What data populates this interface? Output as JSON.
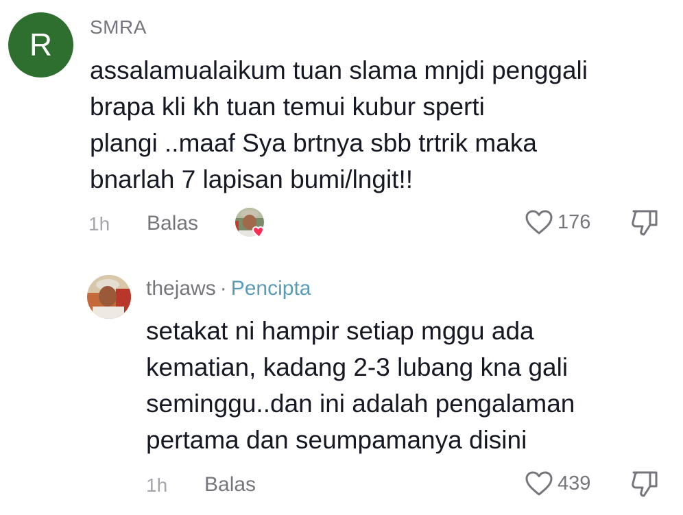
{
  "comment": {
    "avatar_letter": "R",
    "avatar_color": "#2e6e2e",
    "username": "SMRA",
    "text": "assalamualaikum tuan slama mnjdi penggali\nbrapa kli kh tuan temui kubur sperti\nplangi ..maaf Sya brtnya sbb trtrik maka\nbnarlah 7 lapisan bumi/lngit!!",
    "time": "1h",
    "reply_label": "Balas",
    "liked_by_creator_icon": "creator-avatar-with-heart",
    "like_icon": "heart-outline-icon",
    "like_count": "176",
    "dislike_icon": "thumbs-down-icon"
  },
  "reply": {
    "username": "thejaws",
    "separator": "·",
    "badge": "Pencipta",
    "badge_color": "#5a9bb5",
    "text": "setakat ni hampir setiap mggu ada\nkematian, kadang 2-3 lubang kna gali\nseminggu..dan ini adalah pengalaman\npertama dan seumpamanya disini",
    "time": "1h",
    "reply_label": "Balas",
    "like_icon": "heart-outline-icon",
    "like_count": "439",
    "dislike_icon": "thumbs-down-icon"
  }
}
